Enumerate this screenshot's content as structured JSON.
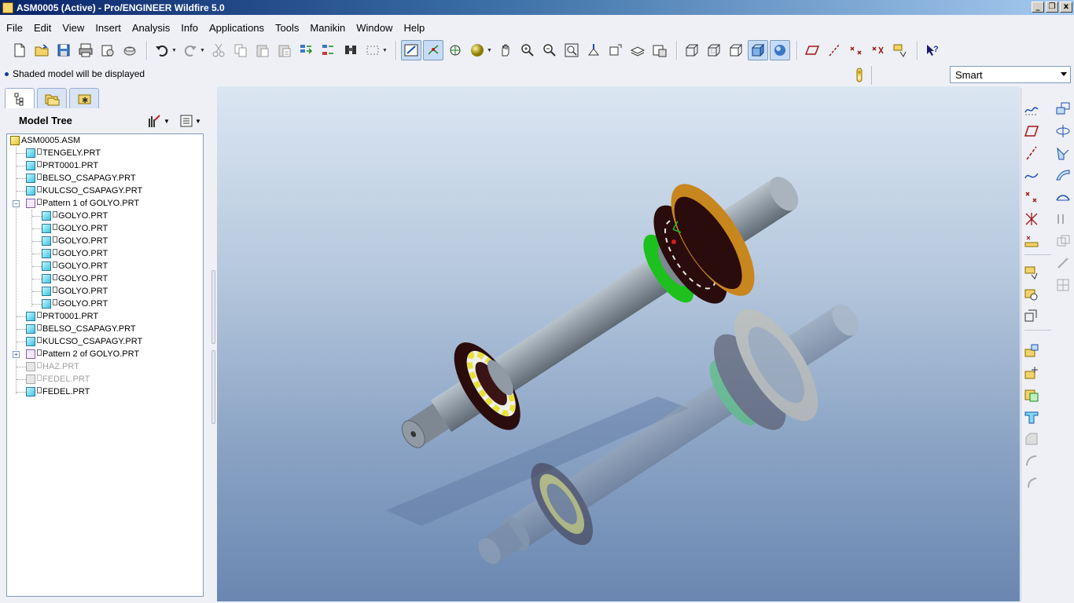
{
  "window": {
    "title": "ASM0005 (Active) - Pro/ENGINEER Wildfire 5.0",
    "minimize_glyph": "_",
    "restore_glyph": "❐",
    "close_glyph": "x"
  },
  "menu": [
    "File",
    "Edit",
    "View",
    "Insert",
    "Analysis",
    "Info",
    "Applications",
    "Tools",
    "Manikin",
    "Window",
    "Help"
  ],
  "toolbar": {
    "icons": [
      "new-icon",
      "open-icon",
      "save-icon",
      "print-icon",
      "send-icon",
      "erase-icon",
      "undo-icon",
      "redo-icon",
      "cut-icon",
      "copy-icon",
      "paste-icon",
      "paste-special-icon",
      "regenerate-icon",
      "regen-manager-icon",
      "find-icon",
      "select-box-icon",
      "repaint-icon",
      "spin-center-icon",
      "orient-mode-icon",
      "appearance-icon",
      "pan-icon",
      "zoom-in-icon",
      "zoom-out-icon",
      "refit-icon",
      "reorient-icon",
      "saved-views-icon",
      "layers-icon",
      "view-manager-icon",
      "wireframe-icon",
      "hidden-line-icon",
      "no-hidden-icon",
      "shaded-icon",
      "enhanced-realism-icon",
      "datum-planes-icon",
      "datum-axes-icon",
      "datum-points-icon",
      "csys-icon",
      "annotations-icon",
      "context-help-icon"
    ],
    "active": [
      "spin-center-icon",
      "shaded-icon",
      "enhanced-realism-icon"
    ]
  },
  "message": "Shaded model displayed",
  "message_full": "Shaded model will be displayed",
  "filter": {
    "selected": "Smart"
  },
  "navigator": {
    "tabs": [
      "model-tree-tab-icon",
      "folder-browser-tab-icon",
      "favorites-tab-icon"
    ],
    "title": "Model Tree",
    "items": [
      {
        "label": "ASM0005.ASM",
        "level": 0,
        "type": "asm"
      },
      {
        "label": "TENGELY.PRT",
        "level": 1,
        "type": "part"
      },
      {
        "label": "PRT0001.PRT",
        "level": 1,
        "type": "part"
      },
      {
        "label": "BELSO_CSAPAGY.PRT",
        "level": 1,
        "type": "part"
      },
      {
        "label": "KULCSO_CSAPAGY.PRT",
        "level": 1,
        "type": "part"
      },
      {
        "label": "Pattern 1 of GOLYO.PRT",
        "level": 1,
        "type": "pattern",
        "expanded": true
      },
      {
        "label": "GOLYO.PRT",
        "level": 2,
        "type": "part"
      },
      {
        "label": "GOLYO.PRT",
        "level": 2,
        "type": "part"
      },
      {
        "label": "GOLYO.PRT",
        "level": 2,
        "type": "part"
      },
      {
        "label": "GOLYO.PRT",
        "level": 2,
        "type": "part"
      },
      {
        "label": "GOLYO.PRT",
        "level": 2,
        "type": "part"
      },
      {
        "label": "GOLYO.PRT",
        "level": 2,
        "type": "part"
      },
      {
        "label": "GOLYO.PRT",
        "level": 2,
        "type": "part"
      },
      {
        "label": "GOLYO.PRT",
        "level": 2,
        "type": "part"
      },
      {
        "label": "PRT0001.PRT",
        "level": 1,
        "type": "part"
      },
      {
        "label": "BELSO_CSAPAGY.PRT",
        "level": 1,
        "type": "part"
      },
      {
        "label": "KULCSO_CSAPAGY.PRT",
        "level": 1,
        "type": "part"
      },
      {
        "label": "Pattern 2 of GOLYO.PRT",
        "level": 1,
        "type": "pattern",
        "expanded": false
      },
      {
        "label": "HAZ.PRT",
        "level": 1,
        "type": "part",
        "suppressed": true
      },
      {
        "label": "FEDEL.PRT",
        "level": 1,
        "type": "part",
        "suppressed": true
      },
      {
        "label": "FEDEL.PRT",
        "level": 1,
        "type": "part"
      }
    ]
  },
  "colors": {
    "title_gradient_start": "#0a246a",
    "title_gradient_end": "#a6caf0",
    "viewport_top": "#dbe6f2",
    "viewport_bottom": "#6a87b1",
    "shaft": "#8f9aa4",
    "bearing_dark": "#2a0c0c",
    "ring_green": "#1ec01e",
    "flange_gold": "#c8861e",
    "ball_yellow": "#e6e23a"
  },
  "right_toolbar": [
    "sketch-icon",
    "plane-icon",
    "axis-icon",
    "curve-icon",
    "point-icon",
    "csys-icon",
    "analysis-icon",
    "annotation-icon",
    "component-placement-icon",
    "extrude-icon",
    "revolve-icon",
    "sweep-icon",
    "blend-icon",
    "round-icon",
    "chamfer-icon",
    "hole-icon",
    "shell-icon",
    "rib-icon",
    "draft-icon",
    "pattern-icon",
    "mirror-icon",
    "merge-icon",
    "trim-icon",
    "intersect-icon"
  ]
}
